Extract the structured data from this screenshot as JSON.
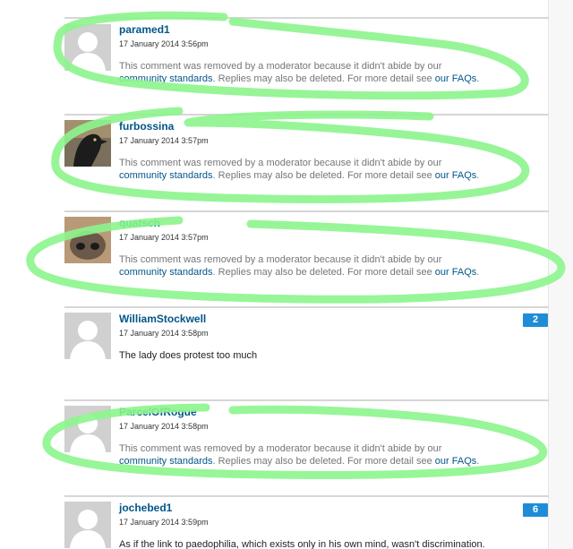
{
  "comments": [
    {
      "username": "paramed1",
      "timestamp": "17 January 2014 3:56pm",
      "avatar": "default-avatar",
      "removed": {
        "text_before": "This comment was removed by a moderator because it didn't abide by our",
        "link1": "community standards",
        "text_middle": ". Replies may also be deleted. For more detail see ",
        "link2": "our FAQs",
        "text_after": "."
      }
    },
    {
      "username": "furbossina",
      "timestamp": "17 January 2014 3:57pm",
      "avatar": "bird-photo-avatar",
      "removed": {
        "text_before": "This comment was removed by a moderator because it didn't abide by our",
        "link1": "community standards",
        "text_middle": ". Replies may also be deleted. For more detail see ",
        "link2": "our FAQs",
        "text_after": "."
      }
    },
    {
      "username": "quatsch",
      "timestamp": "17 January 2014 3:57pm",
      "avatar": "animal-nose-avatar",
      "removed": {
        "text_before": "This comment was removed by a moderator because it didn't abide by our",
        "link1": "community standards",
        "text_middle": ". Replies may also be deleted. For more detail see ",
        "link2": "our FAQs",
        "text_after": "."
      }
    },
    {
      "username": "WilliamStockwell",
      "timestamp": "17 January 2014 3:58pm",
      "avatar": "default-avatar",
      "text": "The lady does protest too much",
      "replies": "2"
    },
    {
      "username": "ParcelOfRogue",
      "timestamp": "17 January 2014 3:58pm",
      "avatar": "default-avatar",
      "removed": {
        "text_before": "This comment was removed by a moderator because it didn't abide by our",
        "link1": "community standards",
        "text_middle": ". Replies may also be deleted. For more detail see ",
        "link2": "our FAQs",
        "text_after": "."
      }
    },
    {
      "username": "jochebed1",
      "timestamp": "17 January 2014 3:59pm",
      "avatar": "default-avatar",
      "text": "As if the link to paedophilia, which exists only in his own mind, wasn't discrimination.",
      "replies": "6"
    }
  ],
  "colors": {
    "username": "#005689",
    "link": "#005689",
    "badge": "#1f8dd6",
    "highlight_marker": "#8cf58c",
    "removed_text": "#767676"
  }
}
